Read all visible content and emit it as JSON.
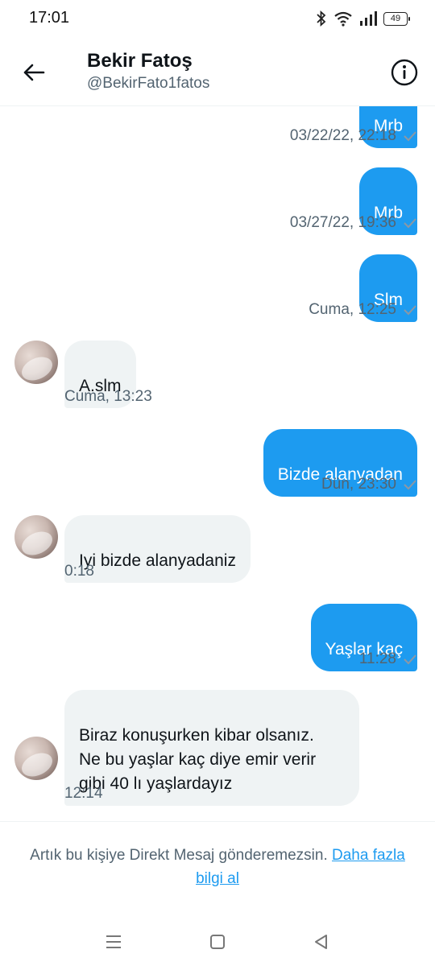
{
  "status_bar": {
    "time": "17:01",
    "battery": "49",
    "icons": [
      "bluetooth-icon",
      "wifi-icon",
      "signal-icon",
      "battery-icon"
    ]
  },
  "header": {
    "name": "Bekir Fatoş",
    "handle": "@BekirFato1fatos",
    "back_icon": "arrow-left-icon",
    "info_icon": "info-icon"
  },
  "colors": {
    "accent": "#1d9bf0",
    "incoming_bubble": "#eff3f4",
    "secondary_text": "#536471"
  },
  "messages": [
    {
      "direction": "out",
      "text": "Mrb",
      "time": "03/22/22, 22:18",
      "read_icon": "check-icon"
    },
    {
      "direction": "out",
      "text": "Mrb",
      "time": "03/27/22, 19:36",
      "read_icon": "check-icon"
    },
    {
      "direction": "out",
      "text": "Slm",
      "time": "Cuma, 12:25",
      "read_icon": "check-icon"
    },
    {
      "direction": "in",
      "text": "A.slm",
      "time": "Cuma, 13:23"
    },
    {
      "direction": "out",
      "text": "Bizde alanyadan",
      "time": "Dün, 23:30",
      "read_icon": "check-icon"
    },
    {
      "direction": "in",
      "text": "Iyi bizde alanyadaniz",
      "time": "0:18"
    },
    {
      "direction": "out",
      "text": "Yaşlar kaç",
      "time": "11:28",
      "read_icon": "check-icon"
    },
    {
      "direction": "in",
      "text": "Biraz konuşurken kibar olsanız.\nNe bu yaşlar kaç  diye emir verir\ngibi   40 lı yaşlardayız",
      "time": "12:14"
    }
  ],
  "notice": {
    "text": "Artık bu kişiye Direkt Mesaj gönderemezsin.",
    "link": "Daha fazla bilgi al"
  },
  "navbar": {
    "icons": [
      "menu-icon",
      "home-square-icon",
      "back-triangle-icon"
    ]
  }
}
